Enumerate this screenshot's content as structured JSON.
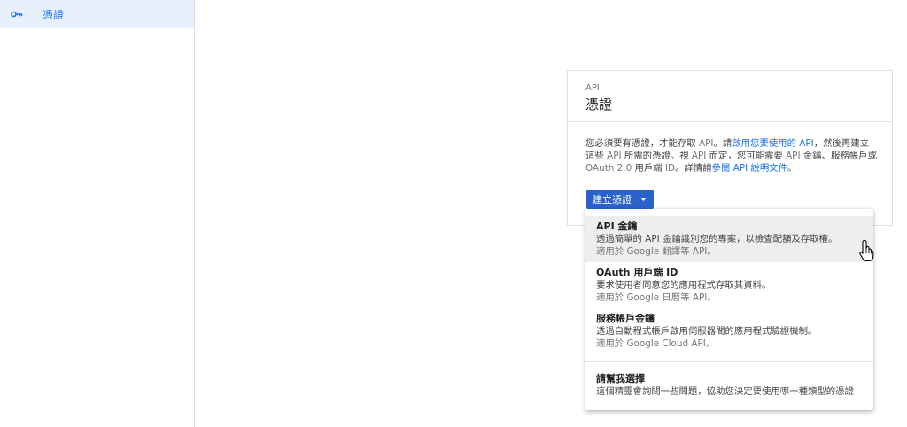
{
  "sidebar": {
    "items": [
      {
        "label": "憑證",
        "icon": "key-icon",
        "active": true
      }
    ]
  },
  "card": {
    "eyebrow": "API",
    "title": "憑證",
    "desc": {
      "p1": "您必須要有憑證，才能存取 ",
      "api1": "API",
      "p2": "。請",
      "link1": "啟用您要使用的 API",
      "p3": "，然後再建立這些 ",
      "api2": "API",
      "p4": " 所需的憑證。視 ",
      "api3": "API",
      "p5": " 而定，您可能需要 ",
      "api4": "API",
      "p6": " 金鑰、服務帳戶或 ",
      "oauth": "OAuth 2.0",
      "p7": " 用戶端 ",
      "id": "ID",
      "p8": "。詳情請",
      "link2": "參閱 API 說明文件",
      "p9": "。"
    },
    "create_button": "建立憑證"
  },
  "menu": {
    "items": [
      {
        "title": "API 金鑰",
        "desc": "透過簡單的 API 金鑰識別您的專案，以檢查配額及存取權。",
        "note": "適用於 Google 翻譯等 API。"
      },
      {
        "title": "OAuth 用戶端 ID",
        "desc": "要求使用者同意您的應用程式存取其資料。",
        "note": "適用於 Google 日曆等 API。"
      },
      {
        "title": "服務帳戶金鑰",
        "desc": "透過自動程式帳戶啟用伺服器間的應用程式驗證機制。",
        "note": "適用於 Google Cloud API。"
      },
      {
        "title": "請幫我選擇",
        "desc": "這個精靈會詢問一些問題，協助您決定要使用哪一種類型的憑證"
      }
    ]
  },
  "colors": {
    "accent": "#1a73e8",
    "button": "#2962ca",
    "active_nav": "#e8f0fe"
  }
}
